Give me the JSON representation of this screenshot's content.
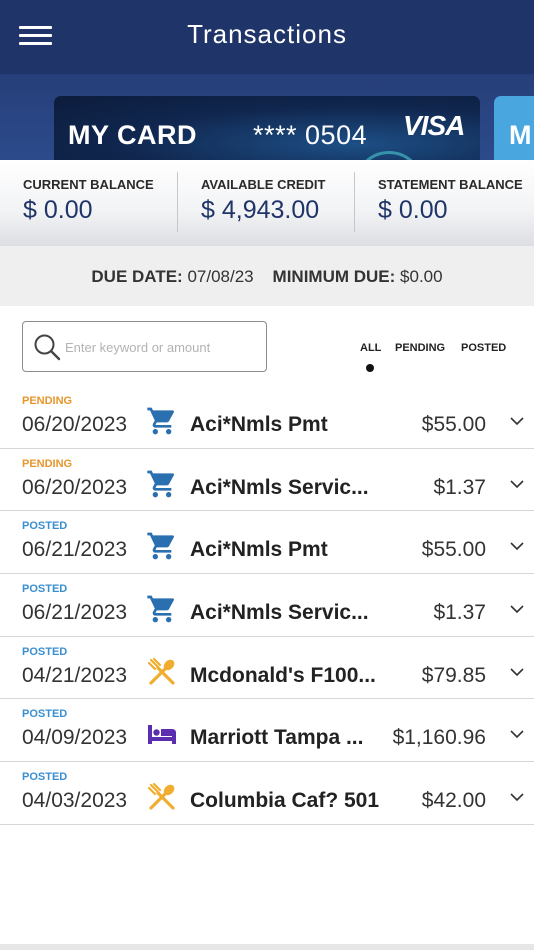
{
  "header": {
    "title": "Transactions",
    "menu_icon": "hamburger-menu-icon"
  },
  "card": {
    "name": "MY CARD",
    "number": "**** 0504",
    "brand": "VISA",
    "next_card_initial": "M"
  },
  "balances": [
    {
      "label": "CURRENT BALANCE",
      "value": "$ 0.00"
    },
    {
      "label": "AVAILABLE CREDIT",
      "value": "$ 4,943.00"
    },
    {
      "label": "STATEMENT BALANCE",
      "value": "$ 0.00"
    }
  ],
  "due": {
    "due_date_label": "DUE DATE:",
    "due_date": "07/08/23",
    "minimum_due_label": "MINIMUM DUE:",
    "minimum_due": "$0.00"
  },
  "search": {
    "placeholder": "Enter keyword or amount",
    "value": ""
  },
  "filters": {
    "tabs": [
      "ALL",
      "PENDING",
      "POSTED"
    ],
    "selected": "ALL"
  },
  "transactions": [
    {
      "status": "PENDING",
      "date": "06/20/2023",
      "category_icon": "shopping-cart-icon",
      "merchant": "Aci*Nmls Pmt",
      "amount": "$55.00"
    },
    {
      "status": "PENDING",
      "date": "06/20/2023",
      "category_icon": "shopping-cart-icon",
      "merchant": "Aci*Nmls Servic...",
      "amount": "$1.37"
    },
    {
      "status": "POSTED",
      "date": "06/21/2023",
      "category_icon": "shopping-cart-icon",
      "merchant": "Aci*Nmls Pmt",
      "amount": "$55.00"
    },
    {
      "status": "POSTED",
      "date": "06/21/2023",
      "category_icon": "shopping-cart-icon",
      "merchant": "Aci*Nmls Servic...",
      "amount": "$1.37"
    },
    {
      "status": "POSTED",
      "date": "04/21/2023",
      "category_icon": "dining-utensils-icon",
      "merchant": "Mcdonald's F100...",
      "amount": "$79.85"
    },
    {
      "status": "POSTED",
      "date": "04/09/2023",
      "category_icon": "hotel-bed-icon",
      "merchant": "Marriott Tampa ...",
      "amount": "$1,160.96"
    },
    {
      "status": "POSTED",
      "date": "04/03/2023",
      "category_icon": "dining-utensils-icon",
      "merchant": "Columbia Caf? 501",
      "amount": "$42.00"
    }
  ],
  "colors": {
    "header_bg": "#1f3468",
    "pending": "#e8962c",
    "posted": "#3a8fd0",
    "cart_icon": "#2a6fb0",
    "dining_icon": "#f0ad2e",
    "hotel_icon": "#5b2db0",
    "balance_value": "#1f3468"
  }
}
